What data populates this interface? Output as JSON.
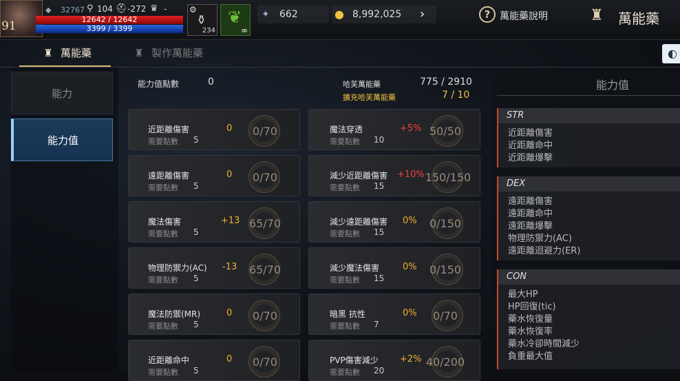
{
  "header": {
    "level": "91",
    "exp": "32767",
    "lawful": "104",
    "defense": "-272",
    "rank": "-",
    "hp": "12642 / 12642",
    "mp": "3399 / 3399",
    "potion_count": "234",
    "leaf_count": "∞",
    "gem_count": "662",
    "gold": "8,992,025",
    "help_label": "萬能藥說明",
    "page_title": "萬能藥"
  },
  "tabs": [
    {
      "label": "萬能藥"
    },
    {
      "label": "製作萬能藥"
    }
  ],
  "side": {
    "ability": "能力",
    "stats": "能力值"
  },
  "summary": {
    "points_label": "能力值點數",
    "points_value": "0",
    "elixir_label": "哈芙萬能藥",
    "elixir_value": "775 / 2910",
    "expand_label": "擴充哈芙萬能藥",
    "expand_value": "7 / 10"
  },
  "req_label": "需要點數",
  "left_cards": [
    {
      "name": "近距離傷害",
      "req": "5",
      "bonus": "0",
      "value": "0/70"
    },
    {
      "name": "遠距離傷害",
      "req": "5",
      "bonus": "0",
      "value": "0/70"
    },
    {
      "name": "魔法傷害",
      "req": "5",
      "bonus": "+13",
      "value": "65/70"
    },
    {
      "name": "物理防禦力(AC)",
      "req": "5",
      "bonus": "-13",
      "value": "65/70"
    },
    {
      "name": "魔法防禦(MR)",
      "req": "5",
      "bonus": "0",
      "value": "0/70"
    },
    {
      "name": "近距離命中",
      "req": "5",
      "bonus": "0",
      "value": "0/70"
    }
  ],
  "right_cards": [
    {
      "name": "魔法穿透",
      "req": "10",
      "bonus": "+5%",
      "value": "50/50"
    },
    {
      "name": "減少近距離傷害",
      "req": "15",
      "bonus": "+10%",
      "value": "150/150"
    },
    {
      "name": "減少遠距離傷害",
      "req": "15",
      "bonus": "0%",
      "value": "0/150"
    },
    {
      "name": "減少魔法傷害",
      "req": "15",
      "bonus": "0%",
      "value": "0/150"
    },
    {
      "name": "暗黑 抗性",
      "req": "7",
      "bonus": "0%",
      "value": "0/70"
    },
    {
      "name": "PVP傷害減少",
      "req": "20",
      "bonus": "+2%",
      "value": "40/200"
    }
  ],
  "panel": {
    "title": "能力值",
    "groups": [
      {
        "name": "STR",
        "items": [
          "近距離傷害",
          "近距離命中",
          "近距離爆擊"
        ]
      },
      {
        "name": "DEX",
        "items": [
          "遠距離傷害",
          "遠距離命中",
          "遠距離爆擊",
          "物理防禦力(AC)",
          "遠距離迴避力(ER)"
        ]
      },
      {
        "name": "CON",
        "items": [
          "最大HP",
          "HP回復(tic)",
          "藥水恢復量",
          "藥水恢復率",
          "藥水冷卻時間減少",
          "負重最大值"
        ]
      }
    ]
  }
}
